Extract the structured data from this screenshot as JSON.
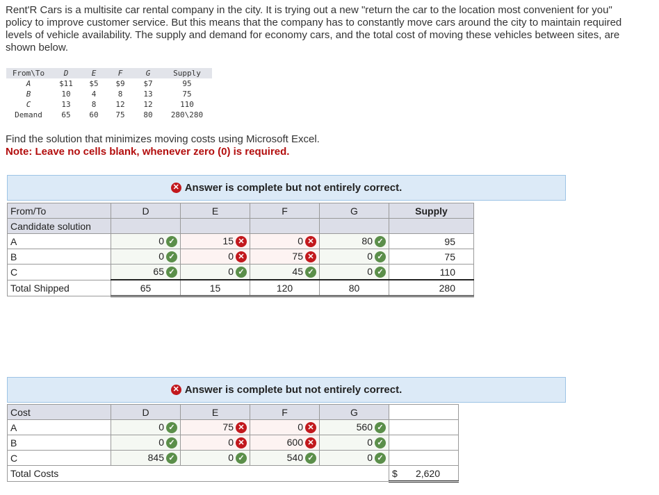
{
  "intro": "Rent'R Cars is a multisite car rental company in the city. It is trying out a new \"return the car to the location most convenient for you\" policy to improve customer service. But this means that the company has to constantly move cars around the city to maintain required levels of vehicle availability. The supply and demand for economy cars, and the total cost of moving these vehicles between sites, are shown below.",
  "given": {
    "header": [
      "From\\To",
      "D",
      "E",
      "F",
      "G",
      "Supply"
    ],
    "rows": [
      [
        "A",
        "$11",
        "$5",
        "$9",
        "$7",
        "95"
      ],
      [
        "B",
        "10",
        "4",
        "8",
        "13",
        "75"
      ],
      [
        "C",
        "13",
        "8",
        "12",
        "12",
        "110"
      ],
      [
        "Demand",
        "65",
        "60",
        "75",
        "80",
        "280\\280"
      ]
    ]
  },
  "find": "Find the solution that minimizes moving costs using Microsoft Excel.",
  "note": "Note: Leave no cells blank, whenever zero (0) is required.",
  "banner1": "Answer is complete but not entirely correct.",
  "banner2": "Answer is complete but not entirely correct.",
  "colors": {
    "correct": "#5b8f4a",
    "incorrect": "#c2181d"
  },
  "solution": {
    "header": [
      "From/To",
      "D",
      "E",
      "F",
      "G",
      "Supply"
    ],
    "subheader": "Candidate solution",
    "rows": [
      {
        "label": "A",
        "cells": [
          {
            "v": "0",
            "ok": true
          },
          {
            "v": "15",
            "ok": false
          },
          {
            "v": "0",
            "ok": false
          },
          {
            "v": "80",
            "ok": true
          }
        ],
        "supply": "95"
      },
      {
        "label": "B",
        "cells": [
          {
            "v": "0",
            "ok": true
          },
          {
            "v": "0",
            "ok": false
          },
          {
            "v": "75",
            "ok": false
          },
          {
            "v": "0",
            "ok": true
          }
        ],
        "supply": "75"
      },
      {
        "label": "C",
        "cells": [
          {
            "v": "65",
            "ok": true
          },
          {
            "v": "0",
            "ok": true
          },
          {
            "v": "45",
            "ok": true
          },
          {
            "v": "0",
            "ok": true
          }
        ],
        "supply": "110"
      }
    ],
    "total_label": "Total Shipped",
    "totals": [
      "65",
      "15",
      "120",
      "80",
      "280"
    ]
  },
  "cost": {
    "header": [
      "Cost",
      "D",
      "E",
      "F",
      "G"
    ],
    "rows": [
      {
        "label": "A",
        "cells": [
          {
            "v": "0",
            "ok": true
          },
          {
            "v": "75",
            "ok": false
          },
          {
            "v": "0",
            "ok": false
          },
          {
            "v": "560",
            "ok": true
          }
        ]
      },
      {
        "label": "B",
        "cells": [
          {
            "v": "0",
            "ok": true
          },
          {
            "v": "0",
            "ok": false
          },
          {
            "v": "600",
            "ok": false
          },
          {
            "v": "0",
            "ok": true
          }
        ]
      },
      {
        "label": "C",
        "cells": [
          {
            "v": "845",
            "ok": true
          },
          {
            "v": "0",
            "ok": true
          },
          {
            "v": "540",
            "ok": true
          },
          {
            "v": "0",
            "ok": true
          }
        ]
      }
    ],
    "total_label": "Total Costs",
    "currency": "$",
    "total": "2,620"
  }
}
